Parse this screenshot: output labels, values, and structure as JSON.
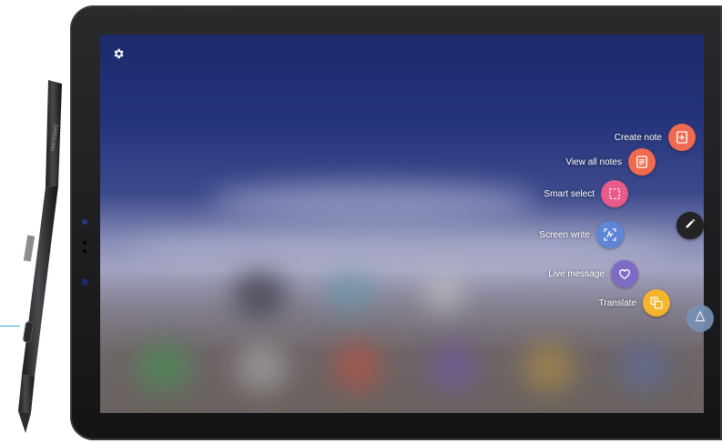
{
  "pen": {
    "brand": "SAMSUNG"
  },
  "screen": {
    "settings_icon": "gear-icon"
  },
  "air_command": {
    "items": [
      {
        "label": "Create note",
        "icon": "create-note-icon",
        "color": "#f06a4f"
      },
      {
        "label": "View all notes",
        "icon": "view-notes-icon",
        "color": "#f06a4f"
      },
      {
        "label": "Smart select",
        "icon": "smart-select-icon",
        "color": "#ea5b8c"
      },
      {
        "label": "Screen write",
        "icon": "screen-write-icon",
        "color": "#5f86d6"
      },
      {
        "label": "Live message",
        "icon": "live-message-icon",
        "color": "#7f6ac6"
      },
      {
        "label": "Translate",
        "icon": "translate-icon",
        "color": "#f4b52a"
      }
    ],
    "toggle_icon": "pen-icon",
    "extra_icon": "add-shortcut-icon",
    "extra_color": "#7691b7"
  }
}
